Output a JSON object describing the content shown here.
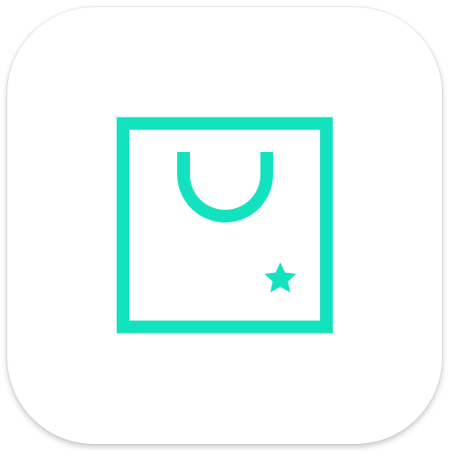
{
  "icon": {
    "semantic": "shopping-bag-with-star-icon",
    "accent_color": "#13e2be",
    "background_color": "#ffffff"
  }
}
